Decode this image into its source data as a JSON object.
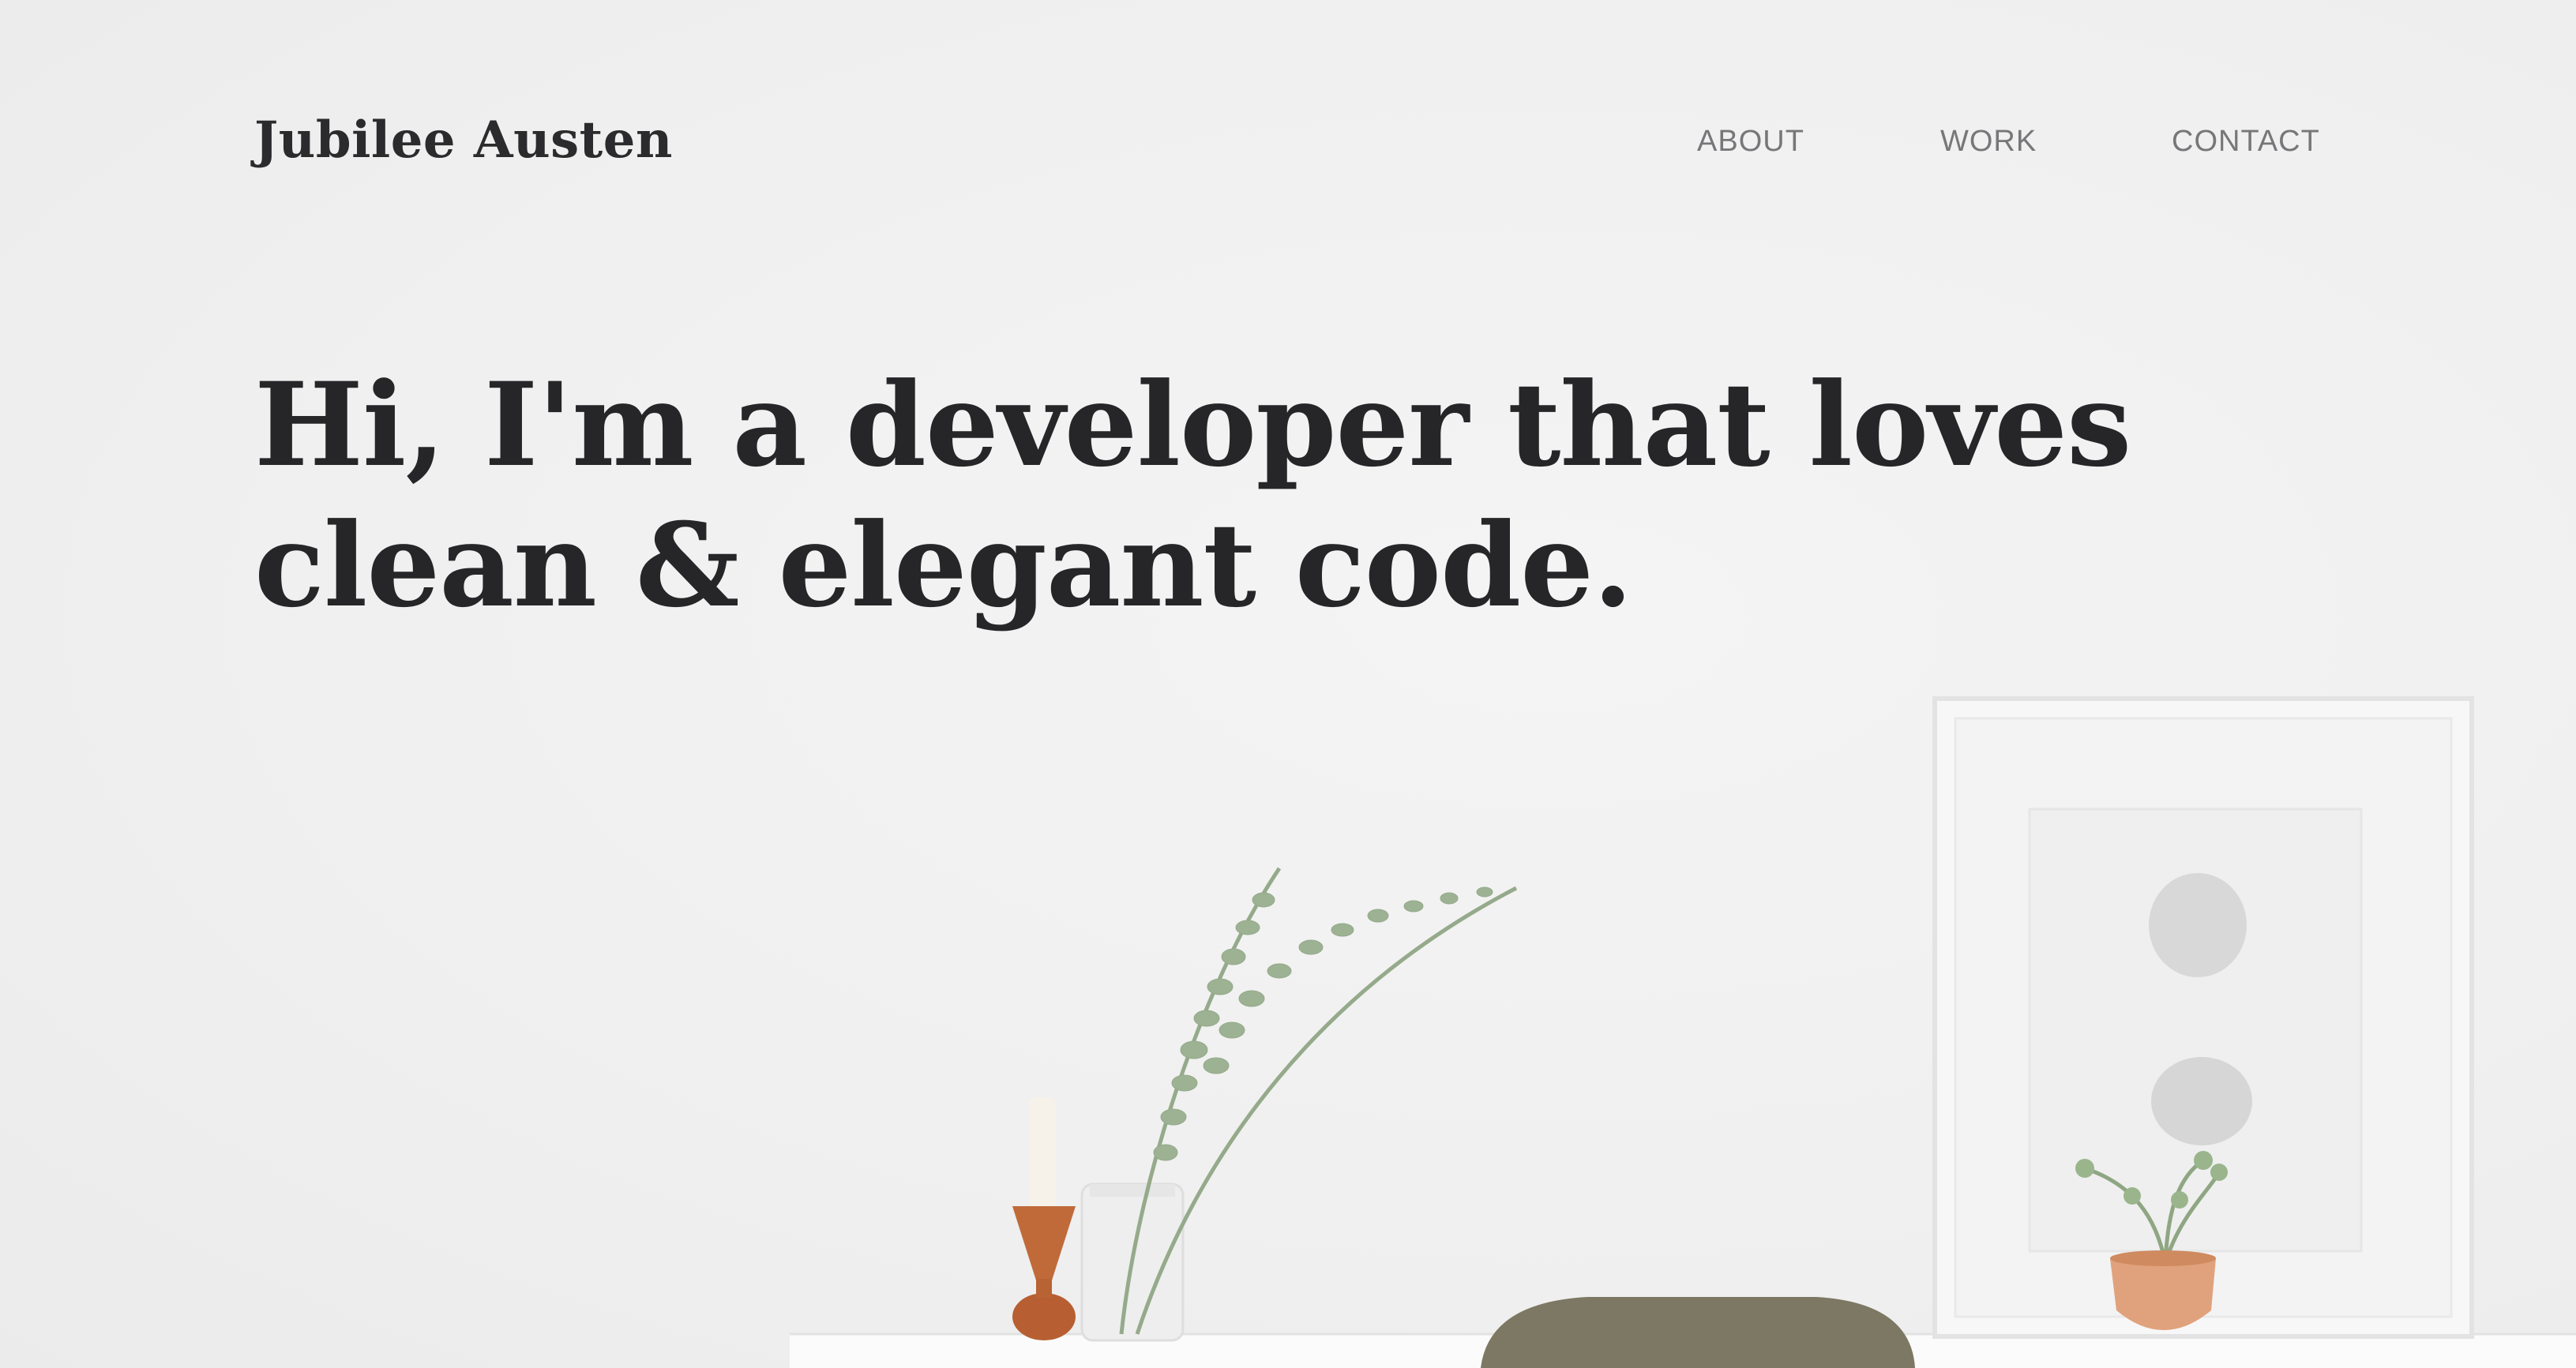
{
  "site": {
    "brand": "Jubilee Austen"
  },
  "nav": {
    "items": [
      {
        "label": "ABOUT"
      },
      {
        "label": "WORK"
      },
      {
        "label": "CONTACT"
      }
    ]
  },
  "hero": {
    "headline_lines": [
      "Hi, I'm a developer that loves",
      "clean & elegant code."
    ]
  },
  "colors": {
    "background": "#f1f1f1",
    "text_dark": "#262629",
    "nav_text": "#77777a",
    "vase_copper": "#c06a3a",
    "plant_green": "#8fa683",
    "chair_olive": "#7c7863"
  }
}
